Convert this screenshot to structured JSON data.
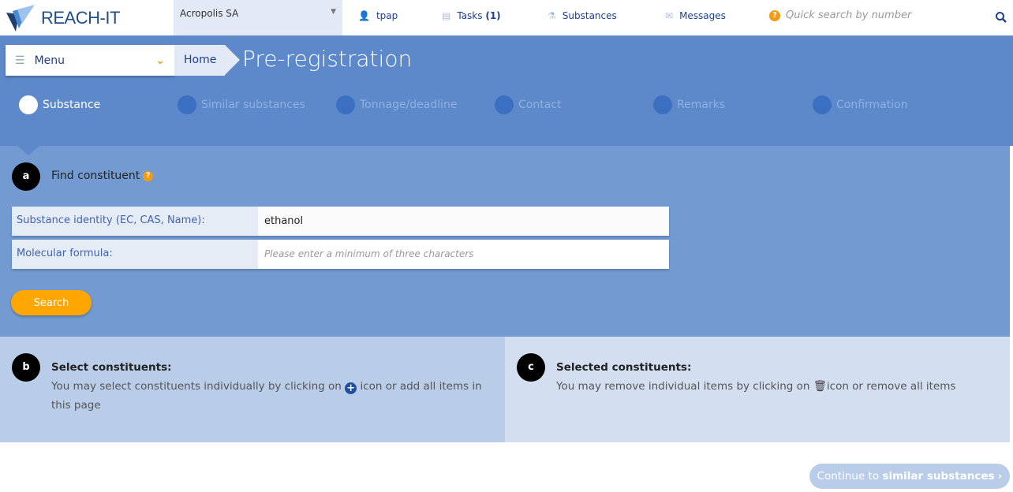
{
  "header": {
    "logo": "REACH-IT",
    "organisation": "Acropolis SA",
    "user": "tpap",
    "tasks_label": "Tasks",
    "tasks_count": "(1)",
    "substances": "Substances",
    "messages": "Messages",
    "quick_search_placeholder": "Quick search by number"
  },
  "nav": {
    "menu": "Menu",
    "breadcrumb_home": "Home",
    "page_title": "Pre-registration"
  },
  "steps": [
    {
      "label": "Substance",
      "active": true
    },
    {
      "label": "Similar substances"
    },
    {
      "label": "Tonnage/deadline"
    },
    {
      "label": "Contact"
    },
    {
      "label": "Remarks"
    },
    {
      "label": "Confirmation"
    }
  ],
  "find": {
    "badge": "a",
    "title": "Find constituent",
    "identity_label": "Substance identity (EC, CAS, Name):",
    "identity_value": "ethanol",
    "formula_label": "Molecular formula:",
    "formula_placeholder": "Please enter a minimum of three characters",
    "search_button": "Search"
  },
  "select": {
    "badge": "b",
    "title": "Select constituents:",
    "text_before": "You may select constituents individually by clicking on",
    "text_after": "icon or add all items in this page"
  },
  "selected": {
    "badge": "c",
    "title": "Selected constituents:",
    "text_before": "You may remove individual items by clicking on",
    "text_after": "icon or remove all items"
  },
  "footer": {
    "continue_prefix": "Continue to",
    "continue_bold": "similar substances"
  },
  "colors": {
    "hero": "#5d89ca",
    "section_a": "#739bd2",
    "accent": "#ffa600"
  }
}
